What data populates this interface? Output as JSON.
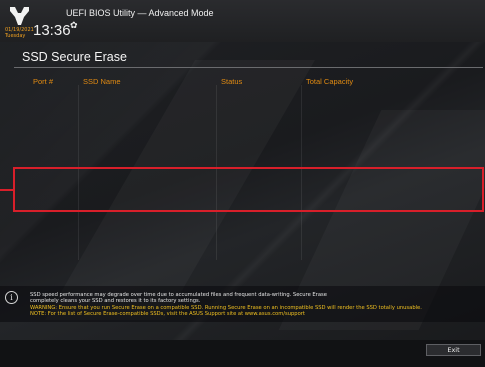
{
  "header": {
    "app_title": "UEFI BIOS Utility — Advanced Mode",
    "date": "01/19/2021",
    "day": "Tuesday",
    "time": "13:36",
    "settings_icon": "gear-icon",
    "logo_icon": "tuf-logo-icon"
  },
  "page": {
    "title": "SSD Secure Erase"
  },
  "table": {
    "columns": [
      "Port #",
      "SSD Name",
      "Status",
      "Total Capacity"
    ],
    "rows": []
  },
  "info": {
    "icon": "info-icon",
    "lines": [
      {
        "text": "SSD speed performance may degrade over time due to accumulated files and frequent data-writing. Secure Erase",
        "style": "white"
      },
      {
        "text": "completely cleans your SSD and restores it to its factory settings.",
        "style": "white"
      },
      {
        "text": "WARNING: Ensure that you run Secure Erase on a compatible SSD. Running Secure Erase on an incompatible SSD will render the SSD totally unusable.",
        "style": "yellow"
      },
      {
        "text": "NOTE: For the list of Secure Erase-compatible SSDs, visit the ASUS Support site at www.asus.com/support",
        "style": "yellow"
      }
    ]
  },
  "footer": {
    "exit_label": "Exit"
  },
  "colors": {
    "accent_orange": "#e08a12",
    "highlight_red": "#d81f2a",
    "warning_yellow": "#f0c020"
  }
}
